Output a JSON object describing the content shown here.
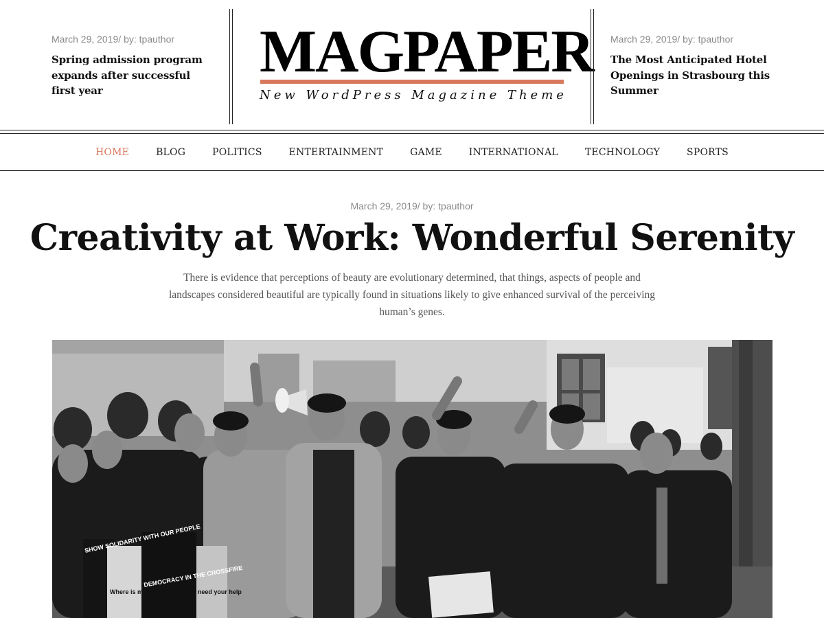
{
  "header": {
    "left_post": {
      "date": "March 29, 2019",
      "separator": "/ by:",
      "author": "tpauthor",
      "title": "Spring admission program expands after successful first year"
    },
    "right_post": {
      "date": "March 29, 2019",
      "separator": "/ by:",
      "author": "tpauthor",
      "title": "The Most Anticipated Hotel Openings in Strasbourg this Summer"
    },
    "logo": "MAGPAPER",
    "tagline": "New WordPress Magazine Theme",
    "accent_color": "#d9775c"
  },
  "nav": {
    "items": [
      {
        "label": "HOME",
        "active": true
      },
      {
        "label": "BLOG"
      },
      {
        "label": "POLITICS"
      },
      {
        "label": "ENTERTAINMENT"
      },
      {
        "label": "GAME"
      },
      {
        "label": "INTERNATIONAL"
      },
      {
        "label": "TECHNOLOGY"
      },
      {
        "label": "SPORTS"
      }
    ]
  },
  "article": {
    "date": "March 29, 2019",
    "separator": "/ by:",
    "author": "tpauthor",
    "title": "Creativity at Work: Wonderful Serenity",
    "excerpt": "There is evidence that perceptions of beauty are evolutionary determined, that things, aspects of people and landscapes considered beautiful are typically found in situations likely to give enhanced survival of the perceiving human’s genes.",
    "image": {
      "sign_1": "SHOW SOLIDARITY WITH OUR PEOPLE",
      "sign_2": "Where is my Democracy? We need your help",
      "sign_3": "DEMOCRACY IN THE CROSSFIRE"
    }
  }
}
